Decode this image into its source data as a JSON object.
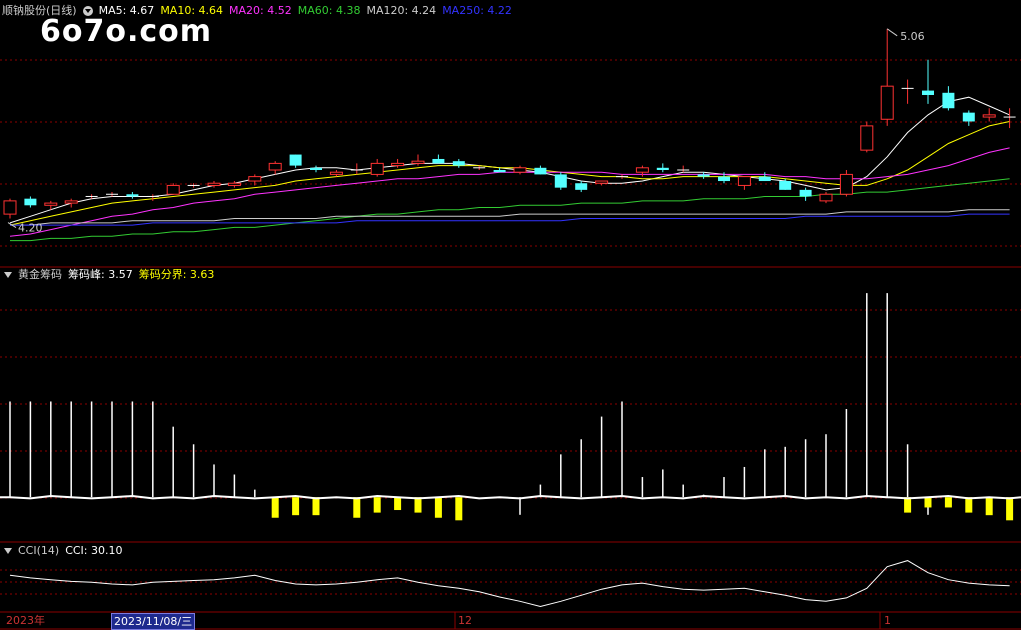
{
  "price_panel": {
    "stock_name": "顺钠股份(日线)",
    "ma_items": [
      {
        "label": "MA5: 4.67",
        "color": "#ffffff"
      },
      {
        "label": "MA10: 4.64",
        "color": "#ffff00"
      },
      {
        "label": "MA20: 4.52",
        "color": "#ff33ff"
      },
      {
        "label": "MA60: 4.38",
        "color": "#33cc33"
      },
      {
        "label": "MA120: 4.24",
        "color": "#cccccc"
      },
      {
        "label": "MA250: 4.22",
        "color": "#3333ff"
      }
    ],
    "high_label": "5.06",
    "low_label": "4.20"
  },
  "watermark": "6o7o.com",
  "chip_panel": {
    "title": "黄金筹码",
    "peak_label": "筹码峰: 3.57",
    "boundary_label": "筹码分界: 3.63"
  },
  "cci_panel": {
    "title": "CCI(14)",
    "value_label": "CCI: 30.10"
  },
  "x_axis": {
    "year_label": "2023年",
    "cursor_date": "2023/11/08/三",
    "month_12": "12",
    "month_1": "1"
  },
  "colors": {
    "up": "#ff3232",
    "down": "#54ffff",
    "grid": "#8b0000",
    "chip_bar": "#ffff00",
    "line_white": "#ffffff"
  },
  "chart_data": [
    {
      "type": "candlestick",
      "title": "顺钠股份(日线)",
      "series": [
        {
          "name": "MA5",
          "value": 4.67
        },
        {
          "name": "MA10",
          "value": 4.64
        },
        {
          "name": "MA20",
          "value": 4.52
        },
        {
          "name": "MA60",
          "value": 4.38
        },
        {
          "name": "MA120",
          "value": 4.24
        },
        {
          "name": "MA250",
          "value": 4.22
        }
      ],
      "ohlc": [
        [
          4.22,
          4.29,
          4.2,
          4.28
        ],
        [
          4.29,
          4.3,
          4.25,
          4.26
        ],
        [
          4.26,
          4.28,
          4.24,
          4.27
        ],
        [
          4.27,
          4.29,
          4.25,
          4.28
        ],
        [
          4.3,
          4.31,
          4.29,
          4.3
        ],
        [
          4.31,
          4.32,
          4.3,
          4.31
        ],
        [
          4.31,
          4.32,
          4.29,
          4.3
        ],
        [
          4.3,
          4.31,
          4.28,
          4.3
        ],
        [
          4.31,
          4.36,
          4.31,
          4.35
        ],
        [
          4.35,
          4.36,
          4.34,
          4.35
        ],
        [
          4.35,
          4.37,
          4.34,
          4.36
        ],
        [
          4.35,
          4.37,
          4.34,
          4.36
        ],
        [
          4.37,
          4.4,
          4.35,
          4.39
        ],
        [
          4.42,
          4.46,
          4.4,
          4.45
        ],
        [
          4.49,
          4.49,
          4.43,
          4.44
        ],
        [
          4.43,
          4.44,
          4.41,
          4.42
        ],
        [
          4.4,
          4.42,
          4.39,
          4.41
        ],
        [
          4.42,
          4.45,
          4.4,
          4.42
        ],
        [
          4.4,
          4.47,
          4.39,
          4.45
        ],
        [
          4.44,
          4.47,
          4.43,
          4.45
        ],
        [
          4.45,
          4.49,
          4.44,
          4.46
        ],
        [
          4.47,
          4.49,
          4.45,
          4.45
        ],
        [
          4.46,
          4.47,
          4.43,
          4.44
        ],
        [
          4.43,
          4.44,
          4.42,
          4.43
        ],
        [
          4.42,
          4.43,
          4.41,
          4.41
        ],
        [
          4.41,
          4.44,
          4.4,
          4.43
        ],
        [
          4.43,
          4.44,
          4.4,
          4.4
        ],
        [
          4.4,
          4.41,
          4.33,
          4.34
        ],
        [
          4.36,
          4.37,
          4.32,
          4.33
        ],
        [
          4.36,
          4.37,
          4.35,
          4.37
        ],
        [
          4.39,
          4.4,
          4.38,
          4.39
        ],
        [
          4.41,
          4.44,
          4.39,
          4.43
        ],
        [
          4.43,
          4.45,
          4.41,
          4.42
        ],
        [
          4.42,
          4.44,
          4.41,
          4.42
        ],
        [
          4.4,
          4.41,
          4.38,
          4.39
        ],
        [
          4.39,
          4.41,
          4.36,
          4.37
        ],
        [
          4.35,
          4.39,
          4.33,
          4.39
        ],
        [
          4.39,
          4.41,
          4.37,
          4.37
        ],
        [
          4.37,
          4.38,
          4.33,
          4.33
        ],
        [
          4.33,
          4.34,
          4.28,
          4.3
        ],
        [
          4.28,
          4.32,
          4.27,
          4.31
        ],
        [
          4.31,
          4.42,
          4.3,
          4.4
        ],
        [
          4.51,
          4.64,
          4.5,
          4.62
        ],
        [
          4.65,
          5.06,
          4.62,
          4.8
        ],
        [
          4.79,
          4.83,
          4.72,
          4.79
        ],
        [
          4.78,
          4.92,
          4.72,
          4.76
        ],
        [
          4.77,
          4.8,
          4.69,
          4.7
        ],
        [
          4.68,
          4.69,
          4.62,
          4.64
        ],
        [
          4.66,
          4.7,
          4.64,
          4.67
        ],
        [
          4.66,
          4.7,
          4.61,
          4.66
        ]
      ],
      "ma_lines": {
        "MA5": [
          4.18,
          4.21,
          4.24,
          4.27,
          4.29,
          4.3,
          4.3,
          4.3,
          4.31,
          4.33,
          4.35,
          4.36,
          4.38,
          4.4,
          4.42,
          4.43,
          4.43,
          4.42,
          4.43,
          4.44,
          4.45,
          4.45,
          4.45,
          4.44,
          4.43,
          4.42,
          4.41,
          4.39,
          4.37,
          4.36,
          4.36,
          4.37,
          4.39,
          4.41,
          4.41,
          4.4,
          4.39,
          4.38,
          4.37,
          4.35,
          4.33,
          4.34,
          4.39,
          4.48,
          4.59,
          4.67,
          4.73,
          4.75,
          4.71,
          4.67
        ],
        "MA10": [
          4.17,
          4.19,
          4.21,
          4.23,
          4.25,
          4.27,
          4.28,
          4.29,
          4.3,
          4.31,
          4.32,
          4.33,
          4.34,
          4.35,
          4.37,
          4.38,
          4.39,
          4.4,
          4.41,
          4.42,
          4.43,
          4.44,
          4.44,
          4.44,
          4.43,
          4.43,
          4.42,
          4.41,
          4.4,
          4.39,
          4.39,
          4.38,
          4.38,
          4.39,
          4.39,
          4.39,
          4.39,
          4.39,
          4.38,
          4.37,
          4.36,
          4.35,
          4.35,
          4.38,
          4.42,
          4.48,
          4.54,
          4.58,
          4.62,
          4.64
        ],
        "MA20": [
          4.12,
          4.13,
          4.15,
          4.17,
          4.19,
          4.21,
          4.22,
          4.24,
          4.25,
          4.27,
          4.28,
          4.29,
          4.31,
          4.32,
          4.33,
          4.34,
          4.35,
          4.36,
          4.37,
          4.38,
          4.38,
          4.39,
          4.4,
          4.4,
          4.41,
          4.41,
          4.41,
          4.41,
          4.41,
          4.41,
          4.4,
          4.4,
          4.4,
          4.4,
          4.4,
          4.4,
          4.4,
          4.4,
          4.39,
          4.39,
          4.38,
          4.38,
          4.38,
          4.39,
          4.4,
          4.42,
          4.44,
          4.47,
          4.5,
          4.52
        ],
        "MA60": [
          4.1,
          4.1,
          4.11,
          4.11,
          4.12,
          4.12,
          4.13,
          4.13,
          4.14,
          4.14,
          4.15,
          4.16,
          4.16,
          4.17,
          4.18,
          4.19,
          4.2,
          4.21,
          4.22,
          4.22,
          4.23,
          4.24,
          4.24,
          4.25,
          4.25,
          4.26,
          4.26,
          4.26,
          4.27,
          4.27,
          4.27,
          4.28,
          4.28,
          4.28,
          4.29,
          4.29,
          4.29,
          4.3,
          4.3,
          4.3,
          4.31,
          4.31,
          4.32,
          4.32,
          4.33,
          4.34,
          4.35,
          4.36,
          4.37,
          4.38
        ],
        "MA120": [
          4.17,
          4.17,
          4.18,
          4.18,
          4.18,
          4.18,
          4.19,
          4.19,
          4.19,
          4.19,
          4.19,
          4.2,
          4.2,
          4.2,
          4.2,
          4.2,
          4.21,
          4.21,
          4.21,
          4.21,
          4.21,
          4.21,
          4.21,
          4.21,
          4.21,
          4.22,
          4.22,
          4.22,
          4.22,
          4.22,
          4.22,
          4.22,
          4.22,
          4.22,
          4.22,
          4.22,
          4.22,
          4.22,
          4.22,
          4.22,
          4.22,
          4.23,
          4.23,
          4.23,
          4.23,
          4.23,
          4.23,
          4.24,
          4.24,
          4.24
        ],
        "MA250": [
          4.17,
          4.17,
          4.17,
          4.17,
          4.17,
          4.17,
          4.17,
          4.18,
          4.18,
          4.18,
          4.18,
          4.18,
          4.18,
          4.18,
          4.18,
          4.18,
          4.18,
          4.19,
          4.19,
          4.19,
          4.19,
          4.19,
          4.19,
          4.19,
          4.19,
          4.19,
          4.19,
          4.19,
          4.2,
          4.2,
          4.2,
          4.2,
          4.2,
          4.2,
          4.2,
          4.2,
          4.2,
          4.2,
          4.2,
          4.21,
          4.21,
          4.21,
          4.21,
          4.21,
          4.21,
          4.21,
          4.21,
          4.22,
          4.22,
          4.22
        ]
      }
    },
    {
      "type": "bar",
      "title": "黄金筹码",
      "series": [
        {
          "name": "筹码峰",
          "values": [
            3.57
          ]
        },
        {
          "name": "筹码分界",
          "values": [
            3.63
          ]
        }
      ],
      "white_bar_levels": [
        0.55,
        0.55,
        0.55,
        0.55,
        0.55,
        0.55,
        0.55,
        0.55,
        0.45,
        0.38,
        0.3,
        0.26,
        0.2,
        0.16,
        0,
        0,
        0,
        0,
        0,
        0,
        0,
        0,
        0,
        0,
        0,
        0.1,
        0.22,
        0.34,
        0.4,
        0.49,
        0.55,
        0.25,
        0.28,
        0.22,
        0.18,
        0.25,
        0.29,
        0.36,
        0.37,
        0.4,
        0.42,
        0.52,
        0.98,
        0.98,
        0.38,
        0.1,
        0,
        0,
        0,
        0
      ],
      "yellow_bar_levels": [
        0,
        0,
        0,
        0,
        0,
        0,
        0,
        0,
        0,
        0,
        0,
        0,
        0,
        0.08,
        0.07,
        0.07,
        0,
        0.08,
        0.06,
        0.05,
        0.06,
        0.08,
        0.09,
        0,
        0,
        0,
        0,
        0,
        0,
        0,
        0,
        0,
        0,
        0,
        0,
        0,
        0,
        0,
        0,
        0,
        0,
        0,
        0,
        0,
        0.06,
        0.04,
        0.04,
        0.06,
        0.07,
        0.09
      ],
      "baseline": 0.17
    },
    {
      "type": "line",
      "title": "CCI(14)",
      "series": [
        {
          "name": "CCI",
          "values": [
            20,
            14,
            10,
            6,
            4,
            0,
            -2,
            4,
            6,
            8,
            10,
            14,
            20,
            8,
            0,
            -2,
            0,
            4,
            10,
            14,
            4,
            -4,
            -10,
            -18,
            -30,
            -40,
            -52,
            -40,
            -26,
            -12,
            -2,
            2,
            -6,
            -12,
            -14,
            -12,
            -10,
            -18,
            -26,
            -36,
            -40,
            -32,
            -10,
            40,
            54,
            26,
            10,
            2,
            -2,
            -4
          ]
        }
      ],
      "current": 30.1
    }
  ]
}
